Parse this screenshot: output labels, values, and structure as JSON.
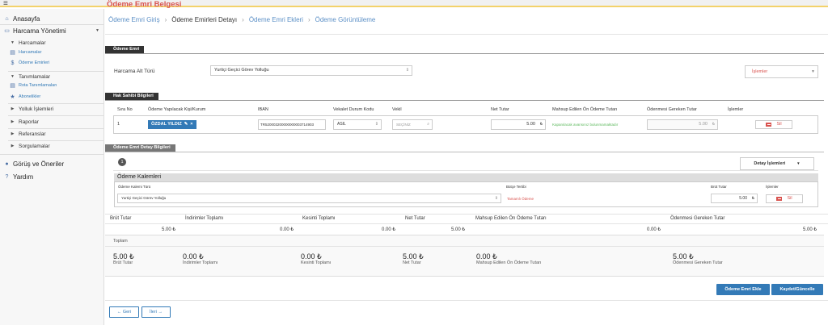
{
  "sidebar": {
    "items": [
      {
        "label": "Anasayfa",
        "icon": "home-icon"
      },
      {
        "label": "Harcama Yönetimi",
        "icon": "wallet-icon"
      },
      {
        "label": "Harcamalar",
        "icon": "caret-down-icon"
      },
      {
        "label": "Harcamalar",
        "icon": "list-icon"
      },
      {
        "label": "Ödeme Emirleri",
        "icon": "currency-icon"
      },
      {
        "label": "Tanımlamalar",
        "icon": "caret-down-icon"
      },
      {
        "label": "Rota Tanımlamaları",
        "icon": "list-icon"
      },
      {
        "label": "Abonelikler",
        "icon": "star-icon"
      },
      {
        "label": "Yolluk İşlemleri",
        "icon": "caret-right-icon"
      },
      {
        "label": "Raporlar",
        "icon": "caret-right-icon"
      },
      {
        "label": "Referanslar",
        "icon": "caret-right-icon"
      },
      {
        "label": "Sorgulamalar",
        "icon": "caret-right-icon"
      },
      {
        "label": "Görüş ve Öneriler",
        "icon": "comment-icon"
      },
      {
        "label": "Yardım",
        "icon": "question-icon"
      }
    ]
  },
  "page": {
    "title": "Ödeme Emri Belgesi"
  },
  "breadcrumb": [
    "Ödeme Emri Giriş",
    "Ödeme Emirleri Detayı",
    "Ödeme Emri Ekleri",
    "Ödeme Görüntüleme"
  ],
  "odeme_emri": {
    "section_label": "Ödeme Emri",
    "harcama_alt_turu_label": "Harcama Alt Türü",
    "harcama_alt_turu_value": "Yurtiçi Geçici Görev Yolluğu",
    "islemler_label": "İşlemler"
  },
  "hak_sahibi": {
    "section_label": "Hak Sahibi Bilgileri",
    "headers": [
      "Sıra No",
      "Ödeme Yapılacak Kişi/Kurum",
      "IBAN",
      "Vekalet Durum Kodu",
      "Vekil",
      "Net Tutar",
      "Mahsup Edilen Ön Ödeme Tutarı",
      "Ödenmesi Gereken Tutar",
      "İşlemler"
    ],
    "row": {
      "sira": "1",
      "kisi": "ÖZDAL YILDIZ",
      "iban": "TR520003200000000003714903",
      "vekalet": "ASIL",
      "vekil": "SEÇİNİZ",
      "net": "5.00",
      "mahsup": "Kapanılacak avansınız bulunmamaktadır",
      "odenmesi": "5.00",
      "sil": "Sil"
    }
  },
  "detay": {
    "section_label": "Ödeme Emri Detay Bilgileri",
    "number": "1",
    "detay_islemleri": "Detay İşlemleri",
    "kalemler_title": "Ödeme Kalemleri",
    "headers": [
      "Ödeme Kalemi Türü",
      "Bütçe Tertibi",
      "Brüt Tutar",
      "İşlemler"
    ],
    "row": {
      "tur": "Yurtiçi Geçici Görev Yolluğu",
      "butce": "Tamamlı Ödeme",
      "brut": "5.00",
      "sil": "Sil"
    },
    "summary_headers": [
      "Brüt Tutar",
      "İndirimler Toplamı",
      "Kesinti Toplamı",
      "Net Tutar",
      "Mahsup Edilen Ön Ödeme Tutarı",
      "Ödenmesi Gereken Tutar"
    ],
    "summary_values": [
      "5.00",
      "0.00",
      "0.00",
      "5.00",
      "0.00",
      "5.00"
    ],
    "toplam_label": "Toplam",
    "totals": [
      {
        "value": "5.00 ₺",
        "label": "Brüt Tutar"
      },
      {
        "value": "0.00 ₺",
        "label": "İndirimler Toplamı"
      },
      {
        "value": "0.00 ₺",
        "label": "Kesinti Toplamı"
      },
      {
        "value": "5.00 ₺",
        "label": "Net Tutar"
      },
      {
        "value": "0.00 ₺",
        "label": "Mahsup Edilen Ön Ödeme Tutarı"
      },
      {
        "value": "5.00 ₺",
        "label": "Ödenmesi Gereken Tutar"
      }
    ]
  },
  "actions": {
    "ekle": "Ödeme Emri Ekle",
    "kaydet": "Kaydet/Güncelle",
    "geri": "Geri",
    "ileri": "İleri"
  },
  "currency": "₺",
  "colors": {
    "accent": "#337ab7",
    "title_red": "#d9534f",
    "section_dark": "#333333"
  }
}
